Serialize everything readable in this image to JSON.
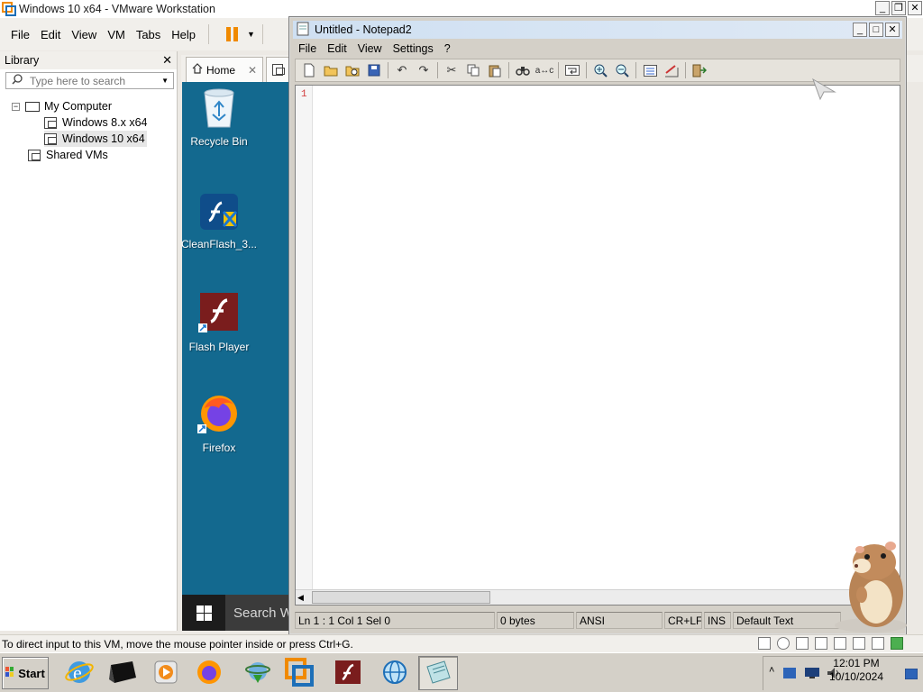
{
  "vmware": {
    "title": "Windows 10 x64 - VMware Workstation",
    "menu": [
      "File",
      "Edit",
      "View",
      "VM",
      "Tabs",
      "Help"
    ],
    "library": {
      "title": "Library",
      "search_placeholder": "Type here to search",
      "tree": {
        "my_computer": "My Computer",
        "vm1": "Windows 8.x x64",
        "vm2": "Windows 10 x64",
        "shared": "Shared VMs"
      }
    },
    "tabs": {
      "home": "Home"
    },
    "status_message": "To direct input to this VM, move the mouse pointer inside or press Ctrl+G."
  },
  "guest": {
    "desktop_icons": [
      {
        "label": "Recycle Bin",
        "icon": "recycle-bin-icon"
      },
      {
        "label": "CleanFlash_3...",
        "icon": "cleanflash-installer-icon"
      },
      {
        "label": "Flash Player",
        "icon": "flash-player-icon"
      },
      {
        "label": "Firefox",
        "icon": "firefox-icon"
      }
    ],
    "taskbar_search": "Search W"
  },
  "notepad": {
    "title": "Untitled - Notepad2",
    "menu": [
      "File",
      "Edit",
      "View",
      "Settings",
      "?"
    ],
    "line_number": "1",
    "status": {
      "position": "Ln 1 : 1   Col 1   Sel 0",
      "size": "0 bytes",
      "encoding": "ANSI",
      "eol": "CR+LF",
      "mode": "INS",
      "scheme": "Default Text"
    }
  },
  "host": {
    "start_label": "Start",
    "clock": {
      "time": "12:01 PM",
      "date": "10/10/2024"
    }
  },
  "colors": {
    "desktop_bg": "#13698f",
    "flash_red": "#7a1d1d",
    "vm_pause": "#f08a00"
  }
}
